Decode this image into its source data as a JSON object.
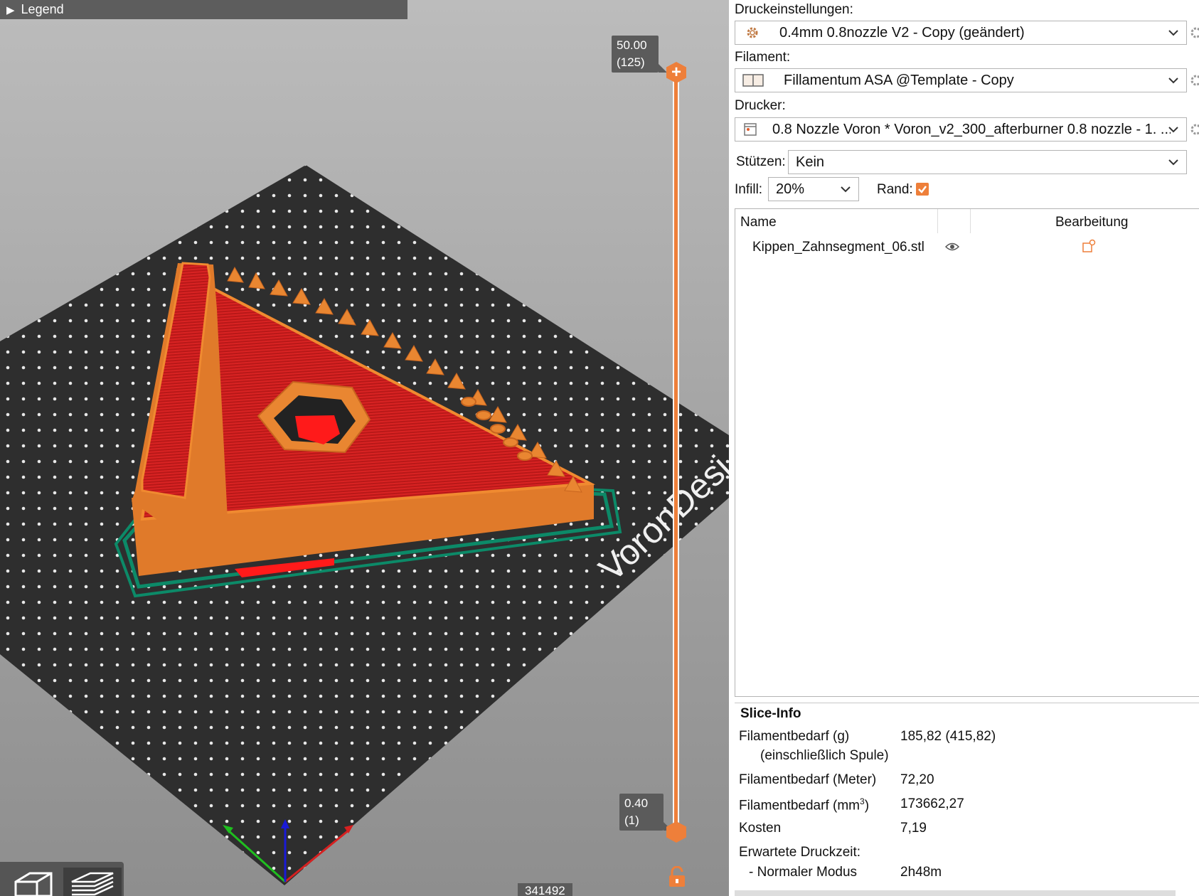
{
  "viewport": {
    "legend_label": "Legend",
    "layer_top": {
      "height": "50.00",
      "layer": "(125)"
    },
    "layer_bottom": {
      "height": "0.40",
      "layer": "(1)"
    },
    "bed_logo": "VoronDesi",
    "count_label": "341492",
    "accent_color": "#ee7f3a"
  },
  "panel": {
    "print_settings": {
      "label": "Druckeinstellungen:",
      "value": "0.4mm 0.8nozzle V2 - Copy (geändert)"
    },
    "filament": {
      "label": "Filament:",
      "value": "Fillamentum ASA @Template - Copy"
    },
    "printer": {
      "label": "Drucker:",
      "value": "0.8 Nozzle Voron  * Voron_v2_300_afterburner 0.8 nozzle - 1. ..."
    },
    "supports": {
      "label": "Stützen:",
      "value": "Kein"
    },
    "infill": {
      "label": "Infill:",
      "value": "20%"
    },
    "brim": {
      "label": "Rand:",
      "checked": true
    },
    "object_list": {
      "columns": {
        "name": "Name",
        "edit": "Bearbeitung"
      },
      "items": [
        {
          "name": "Kippen_Zahnsegment_06.stl"
        }
      ]
    },
    "slice_info": {
      "title": "Slice-Info",
      "rows": [
        {
          "label": "Filamentbedarf (g)",
          "value": "185,82 (415,82)"
        },
        {
          "label": "(einschließlich Spule)",
          "value": ""
        },
        {
          "label": "Filamentbedarf (Meter)",
          "value": "72,20"
        },
        {
          "label": "Filamentbedarf (mm³)",
          "value": "173662,27"
        },
        {
          "label": "Kosten",
          "value": "7,19"
        },
        {
          "label": "Erwartete Druckzeit:",
          "value": ""
        },
        {
          "label": "- Normaler Modus",
          "value": "2h48m"
        }
      ]
    }
  }
}
